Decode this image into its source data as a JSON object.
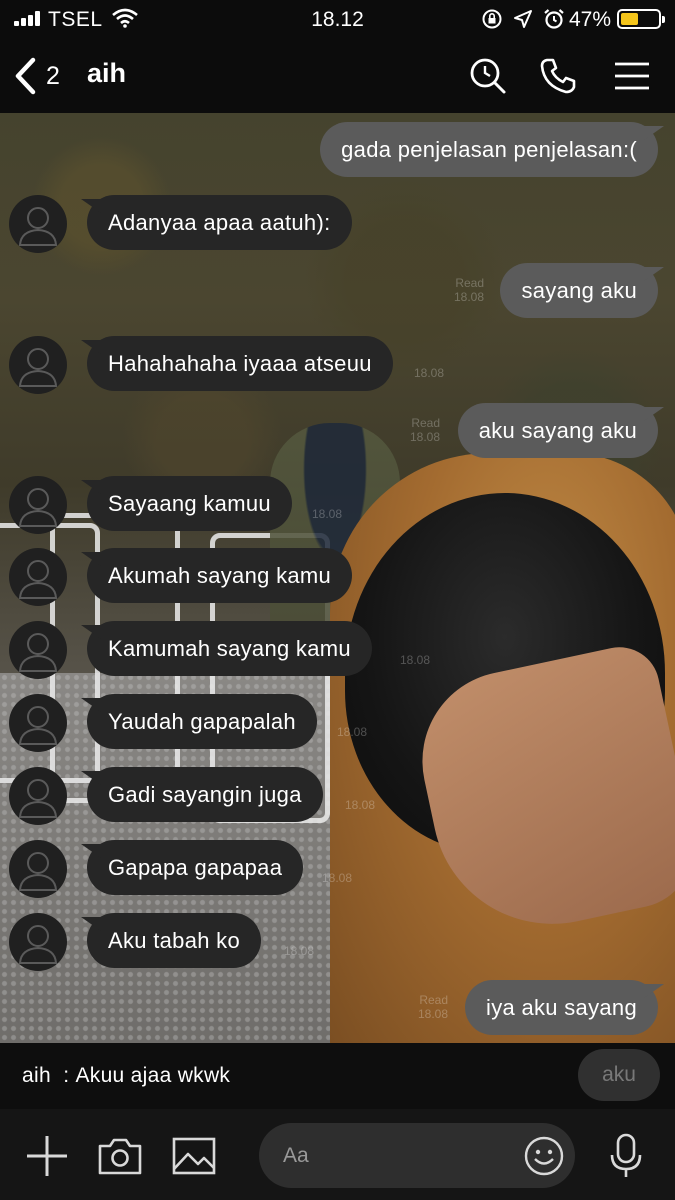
{
  "status_bar": {
    "carrier": "TSEL",
    "time": "18.12",
    "battery_percent": "47%",
    "battery_level": 0.47,
    "battery_color": "#f4c51b",
    "icons": [
      "signal-icon",
      "wifi-icon",
      "screen-lock-icon",
      "location-icon",
      "alarm-icon",
      "battery-icon"
    ]
  },
  "header": {
    "back_count": "2",
    "title": "aih",
    "icons": [
      "back-chevron-icon",
      "search-icon",
      "phone-icon",
      "menu-icon"
    ]
  },
  "messages": [
    {
      "side": "out",
      "text": "gada penjelasan penjelasan:("
    },
    {
      "side": "in",
      "text": "Adanyaa apaa aatuh):"
    },
    {
      "side": "out",
      "text": "sayang aku",
      "read": "Read",
      "time": "18.08"
    },
    {
      "side": "in",
      "text": "Hahahahaha iyaaa atseuu",
      "time": "18.08"
    },
    {
      "side": "out",
      "text": "aku sayang aku",
      "read": "Read",
      "time": "18.08"
    },
    {
      "side": "in",
      "text": "Sayaang kamuu",
      "time": "18.08"
    },
    {
      "side": "in",
      "text": "Akumah sayang kamu"
    },
    {
      "side": "in",
      "text": "Kamumah sayang kamu",
      "time": "18.08"
    },
    {
      "side": "in",
      "text": "Yaudah gapapalah",
      "time": "18.08"
    },
    {
      "side": "in",
      "text": "Gadi sayangin juga",
      "time": "18.08"
    },
    {
      "side": "in",
      "text": "Gapapa gapapaa",
      "time": "18.08"
    },
    {
      "side": "in",
      "text": "Aku tabah ko",
      "time": "18.08"
    },
    {
      "side": "out",
      "text": "iya aku sayang",
      "read": "Read",
      "time": "18.08"
    }
  ],
  "preview": {
    "text": "aih  : Akuu ajaa wkwk",
    "ghost_bubble": "aku"
  },
  "input_bar": {
    "placeholder": "Aa",
    "icons": [
      "plus-icon",
      "camera-icon",
      "image-icon",
      "emoji-icon",
      "microphone-icon"
    ]
  }
}
